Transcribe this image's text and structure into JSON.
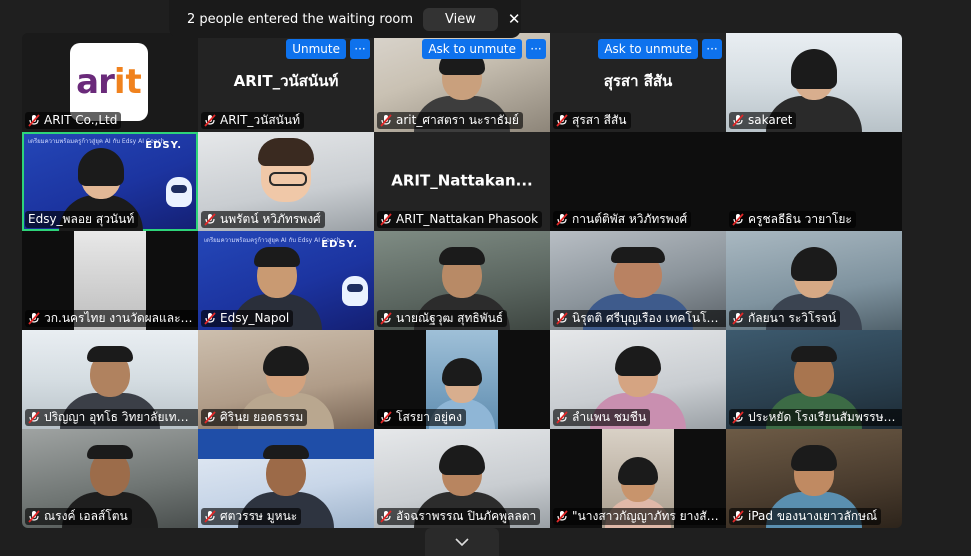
{
  "notification": {
    "message": "2 people entered the waiting room",
    "view_label": "View",
    "close_icon": "close-icon"
  },
  "tile_actions": {
    "unmute_label": "Unmute",
    "ask_to_unmute_label": "Ask to unmute",
    "more_label": "···"
  },
  "participants": [
    {
      "name": "ARIT Co.,Ltd",
      "muted": true
    },
    {
      "name": "ARIT_วนัสนันท์",
      "display": "ARIT_วนัสนันท์",
      "muted": true
    },
    {
      "name": "arit_ศาสตรา นะราธัมย์",
      "muted": true
    },
    {
      "name": "สุรสา สีสัน",
      "display": "สุรสา สีสัน",
      "muted": true
    },
    {
      "name": "sakaret",
      "muted": true
    },
    {
      "name": "Edsy_พลอย สุวนันท์",
      "muted": false
    },
    {
      "name": "นพรัตน์ หวิภัทรพงศ์",
      "muted": true
    },
    {
      "name": "ARIT_Nattakan Phasook",
      "display": "ARIT_Nattakan...",
      "muted": true
    },
    {
      "name": "กานต์ติพัส หวิภัทรพงศ์",
      "muted": true
    },
    {
      "name": "ครูชลธีธิน วายาโยะ",
      "muted": true
    },
    {
      "name": "วก.นครไทย งานวัดผลและประ...",
      "muted": true
    },
    {
      "name": "Edsy_Napol",
      "muted": true
    },
    {
      "name": "นายณัฐวุฒ สุทธิพันธ์",
      "muted": true
    },
    {
      "name": "นิรุตติ ศรีบุญเรือง เทคโนโลยีอ...",
      "muted": true
    },
    {
      "name": "กัลยนา ระวิโรจน์",
      "muted": true
    },
    {
      "name": "ปริญญา อุทโธ วิทยาลัยเทคโ...",
      "muted": true
    },
    {
      "name": "ศิรินย ยอดธรรม",
      "muted": true
    },
    {
      "name": "โสรยา อยู่คง",
      "muted": true
    },
    {
      "name": "ลำแพน ชมชื่น",
      "muted": true
    },
    {
      "name": "ประหยัด โรงเรียนสัมพรรษพิช...",
      "muted": true
    },
    {
      "name": "ณรงค์ เอลส์โตน",
      "muted": true
    },
    {
      "name": "ศตวรรษ มูหนะ",
      "muted": true
    },
    {
      "name": "อัจฉราพรรณ ปินภัคพูลลดา",
      "muted": true
    },
    {
      "name": "\"นางสาวกัญญาภัทร ยางสัน...",
      "muted": true
    },
    {
      "name": "iPad ของนางเยาวลักษณ์",
      "muted": true
    }
  ],
  "arit_logo": {
    "a": "ar",
    "t": "it"
  },
  "edsy": {
    "brand": "EDSY.",
    "banner": "เตรียมความพร้อมครูก้าวสู่ยุค AI กับ Edsy AI Coach"
  },
  "colors": {
    "accent": "#0e72ed",
    "active_speaker": "#2ed47a",
    "muted_mic": "#e02828"
  }
}
